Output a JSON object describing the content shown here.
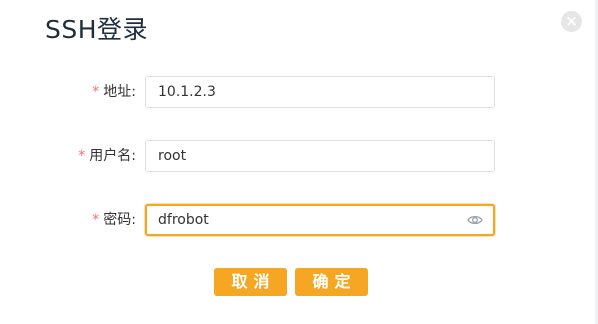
{
  "dialog": {
    "title": "SSH登录",
    "close_icon": "close-icon"
  },
  "form": {
    "required_mark": "*",
    "address": {
      "label": "地址:",
      "value": "10.1.2.3"
    },
    "username": {
      "label": "用户名:",
      "value": "root"
    },
    "password": {
      "label": "密码:",
      "value": "dfrobot",
      "toggle_icon": "eye-icon"
    }
  },
  "buttons": {
    "cancel": "取消",
    "confirm": "确定"
  },
  "colors": {
    "accent": "#f5a623",
    "required": "#f56c6c",
    "title": "#1f2d3d",
    "border": "#dcdfe6"
  }
}
